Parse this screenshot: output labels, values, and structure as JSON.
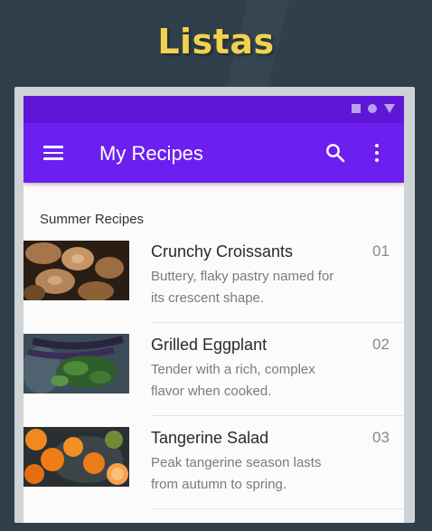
{
  "slide": {
    "title": "Listas"
  },
  "app": {
    "title": "My Recipes",
    "primary_color": "#6d1ff0",
    "status_color": "#5e17d6"
  },
  "section": {
    "header": "Summer Recipes"
  },
  "recipes": [
    {
      "title": "Crunchy Croissants",
      "description": "Buttery, flaky pastry named for its crescent shape.",
      "number": "01",
      "thumbnail": "croissant-image"
    },
    {
      "title": "Grilled Eggplant",
      "description": "Tender with a rich, complex flavor when cooked.",
      "number": "02",
      "thumbnail": "eggplant-image"
    },
    {
      "title": "Tangerine Salad",
      "description": "Peak tangerine season lasts from autumn to spring.",
      "number": "03",
      "thumbnail": "tangerine-image"
    }
  ],
  "icons": {
    "menu": "hamburger-menu-icon",
    "search": "search-icon",
    "more": "more-vert-icon"
  }
}
